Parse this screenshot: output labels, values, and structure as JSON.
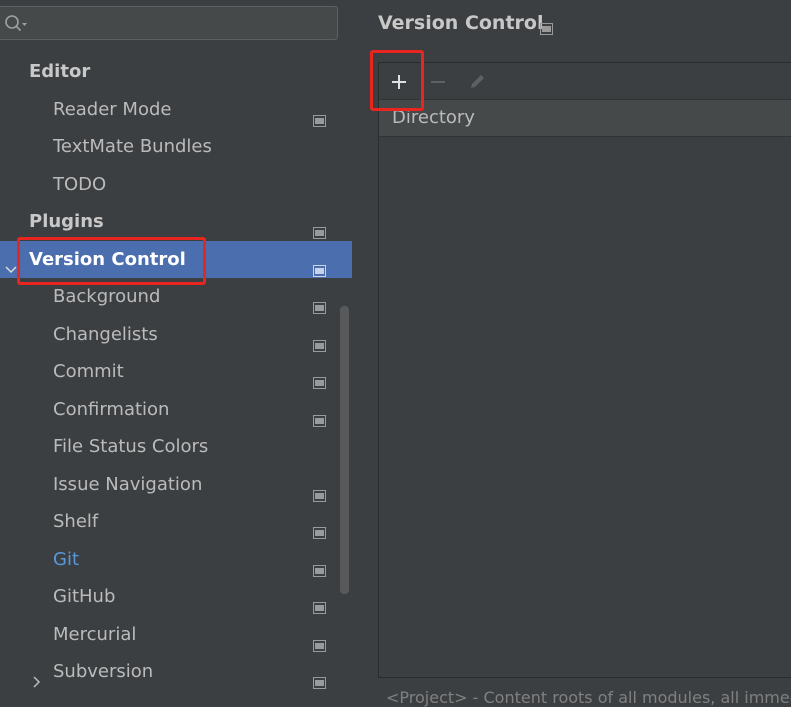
{
  "colors": {
    "background": "#3c3f41",
    "selection": "#4b6eaf",
    "link": "#5897de",
    "highlight": "#e8261f"
  },
  "search": {
    "value": "",
    "placeholder": ""
  },
  "tree": {
    "items": [
      {
        "label": "Editor",
        "level": "top",
        "has_icon": false
      },
      {
        "label": "Reader Mode",
        "level": "child",
        "has_icon": true
      },
      {
        "label": "TextMate Bundles",
        "level": "child",
        "has_icon": false
      },
      {
        "label": "TODO",
        "level": "child",
        "has_icon": false
      },
      {
        "label": "Plugins",
        "level": "top",
        "has_icon": true
      },
      {
        "label": "Version Control",
        "level": "top",
        "has_icon": true,
        "selected": true,
        "expanded": true
      },
      {
        "label": "Background",
        "level": "child",
        "has_icon": true
      },
      {
        "label": "Changelists",
        "level": "child",
        "has_icon": true
      },
      {
        "label": "Commit",
        "level": "child",
        "has_icon": true
      },
      {
        "label": "Confirmation",
        "level": "child",
        "has_icon": true
      },
      {
        "label": "File Status Colors",
        "level": "child",
        "has_icon": false
      },
      {
        "label": "Issue Navigation",
        "level": "child",
        "has_icon": true
      },
      {
        "label": "Shelf",
        "level": "child",
        "has_icon": true
      },
      {
        "label": "Git",
        "level": "child",
        "has_icon": true,
        "link": true
      },
      {
        "label": "GitHub",
        "level": "child",
        "has_icon": true
      },
      {
        "label": "Mercurial",
        "level": "child",
        "has_icon": true
      },
      {
        "label": "Subversion",
        "level": "child",
        "has_icon": true,
        "collapsed": true
      }
    ]
  },
  "content": {
    "title": "Version Control",
    "toolbar": {
      "icons": [
        "add-icon",
        "remove-icon",
        "edit-icon"
      ]
    },
    "table": {
      "columns": [
        "Directory"
      ],
      "rows": []
    },
    "footnote": "<Project> - Content roots of all modules, all immedi"
  }
}
